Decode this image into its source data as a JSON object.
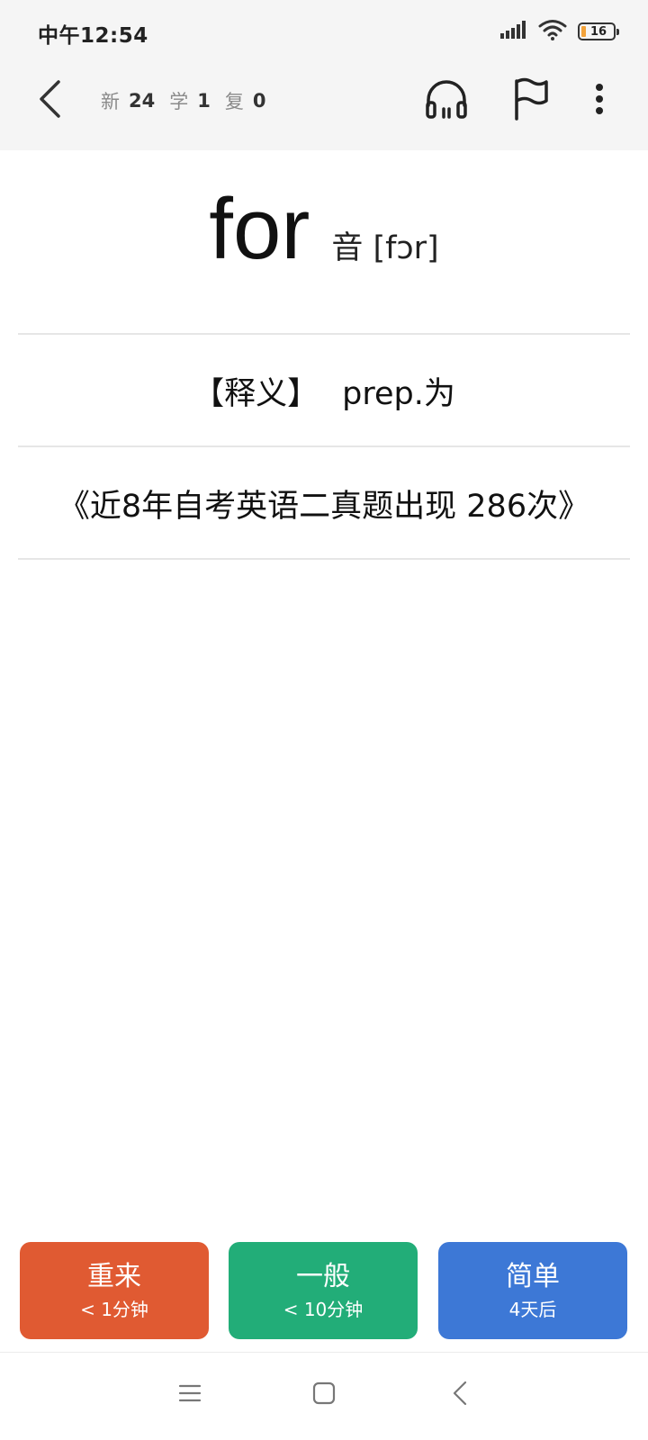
{
  "status_bar": {
    "time": "中午12:54",
    "battery_level": "16"
  },
  "toolbar": {
    "counts": [
      {
        "label": "新",
        "value": "24"
      },
      {
        "label": "学",
        "value": "1"
      },
      {
        "label": "复",
        "value": "0"
      }
    ]
  },
  "card": {
    "word": "for",
    "phonetic": "音 [fɔr]",
    "definition_tag": "【释义】",
    "definition": "prep.为",
    "frequency": "《近8年自考英语二真题出现 286次》"
  },
  "answers": [
    {
      "label": "重来",
      "interval": "< 1分钟",
      "color": "#e05a32"
    },
    {
      "label": "一般",
      "interval": "< 10分钟",
      "color": "#22ad78"
    },
    {
      "label": "简单",
      "interval": "4天后",
      "color": "#3d78d6"
    }
  ],
  "icons": {
    "back": "chevron-left-icon",
    "audio": "headphones-icon",
    "flag": "flag-icon",
    "menu": "more-vertical-icon"
  }
}
